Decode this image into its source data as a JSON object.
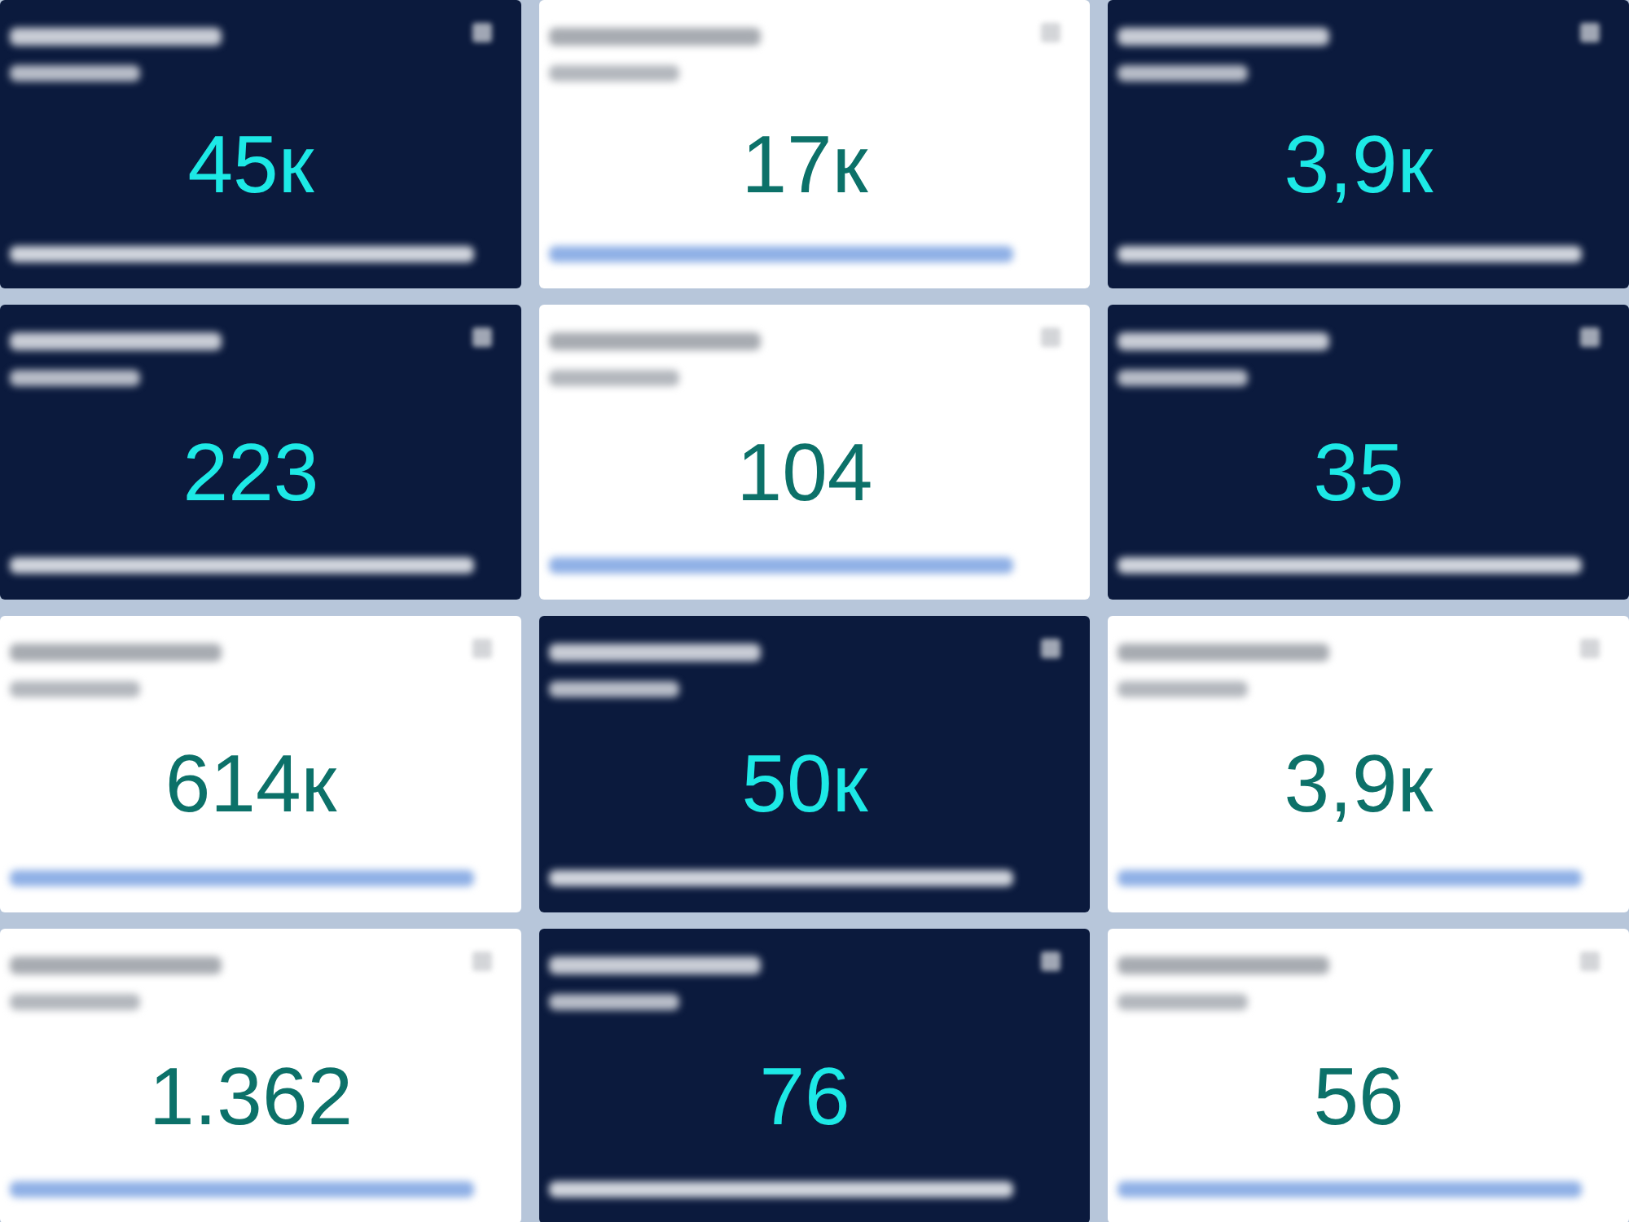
{
  "cards": [
    {
      "kind": "dark",
      "value": "45к"
    },
    {
      "kind": "light",
      "value": "17к"
    },
    {
      "kind": "dark",
      "value": "3,9к"
    },
    {
      "kind": "dark",
      "value": "223"
    },
    {
      "kind": "light",
      "value": "104"
    },
    {
      "kind": "dark",
      "value": "35"
    },
    {
      "kind": "light",
      "value": "614к"
    },
    {
      "kind": "dark",
      "value": "50к"
    },
    {
      "kind": "light",
      "value": "3,9к"
    },
    {
      "kind": "light",
      "value": "1.362"
    },
    {
      "kind": "dark",
      "value": "76"
    },
    {
      "kind": "light",
      "value": "56"
    }
  ]
}
